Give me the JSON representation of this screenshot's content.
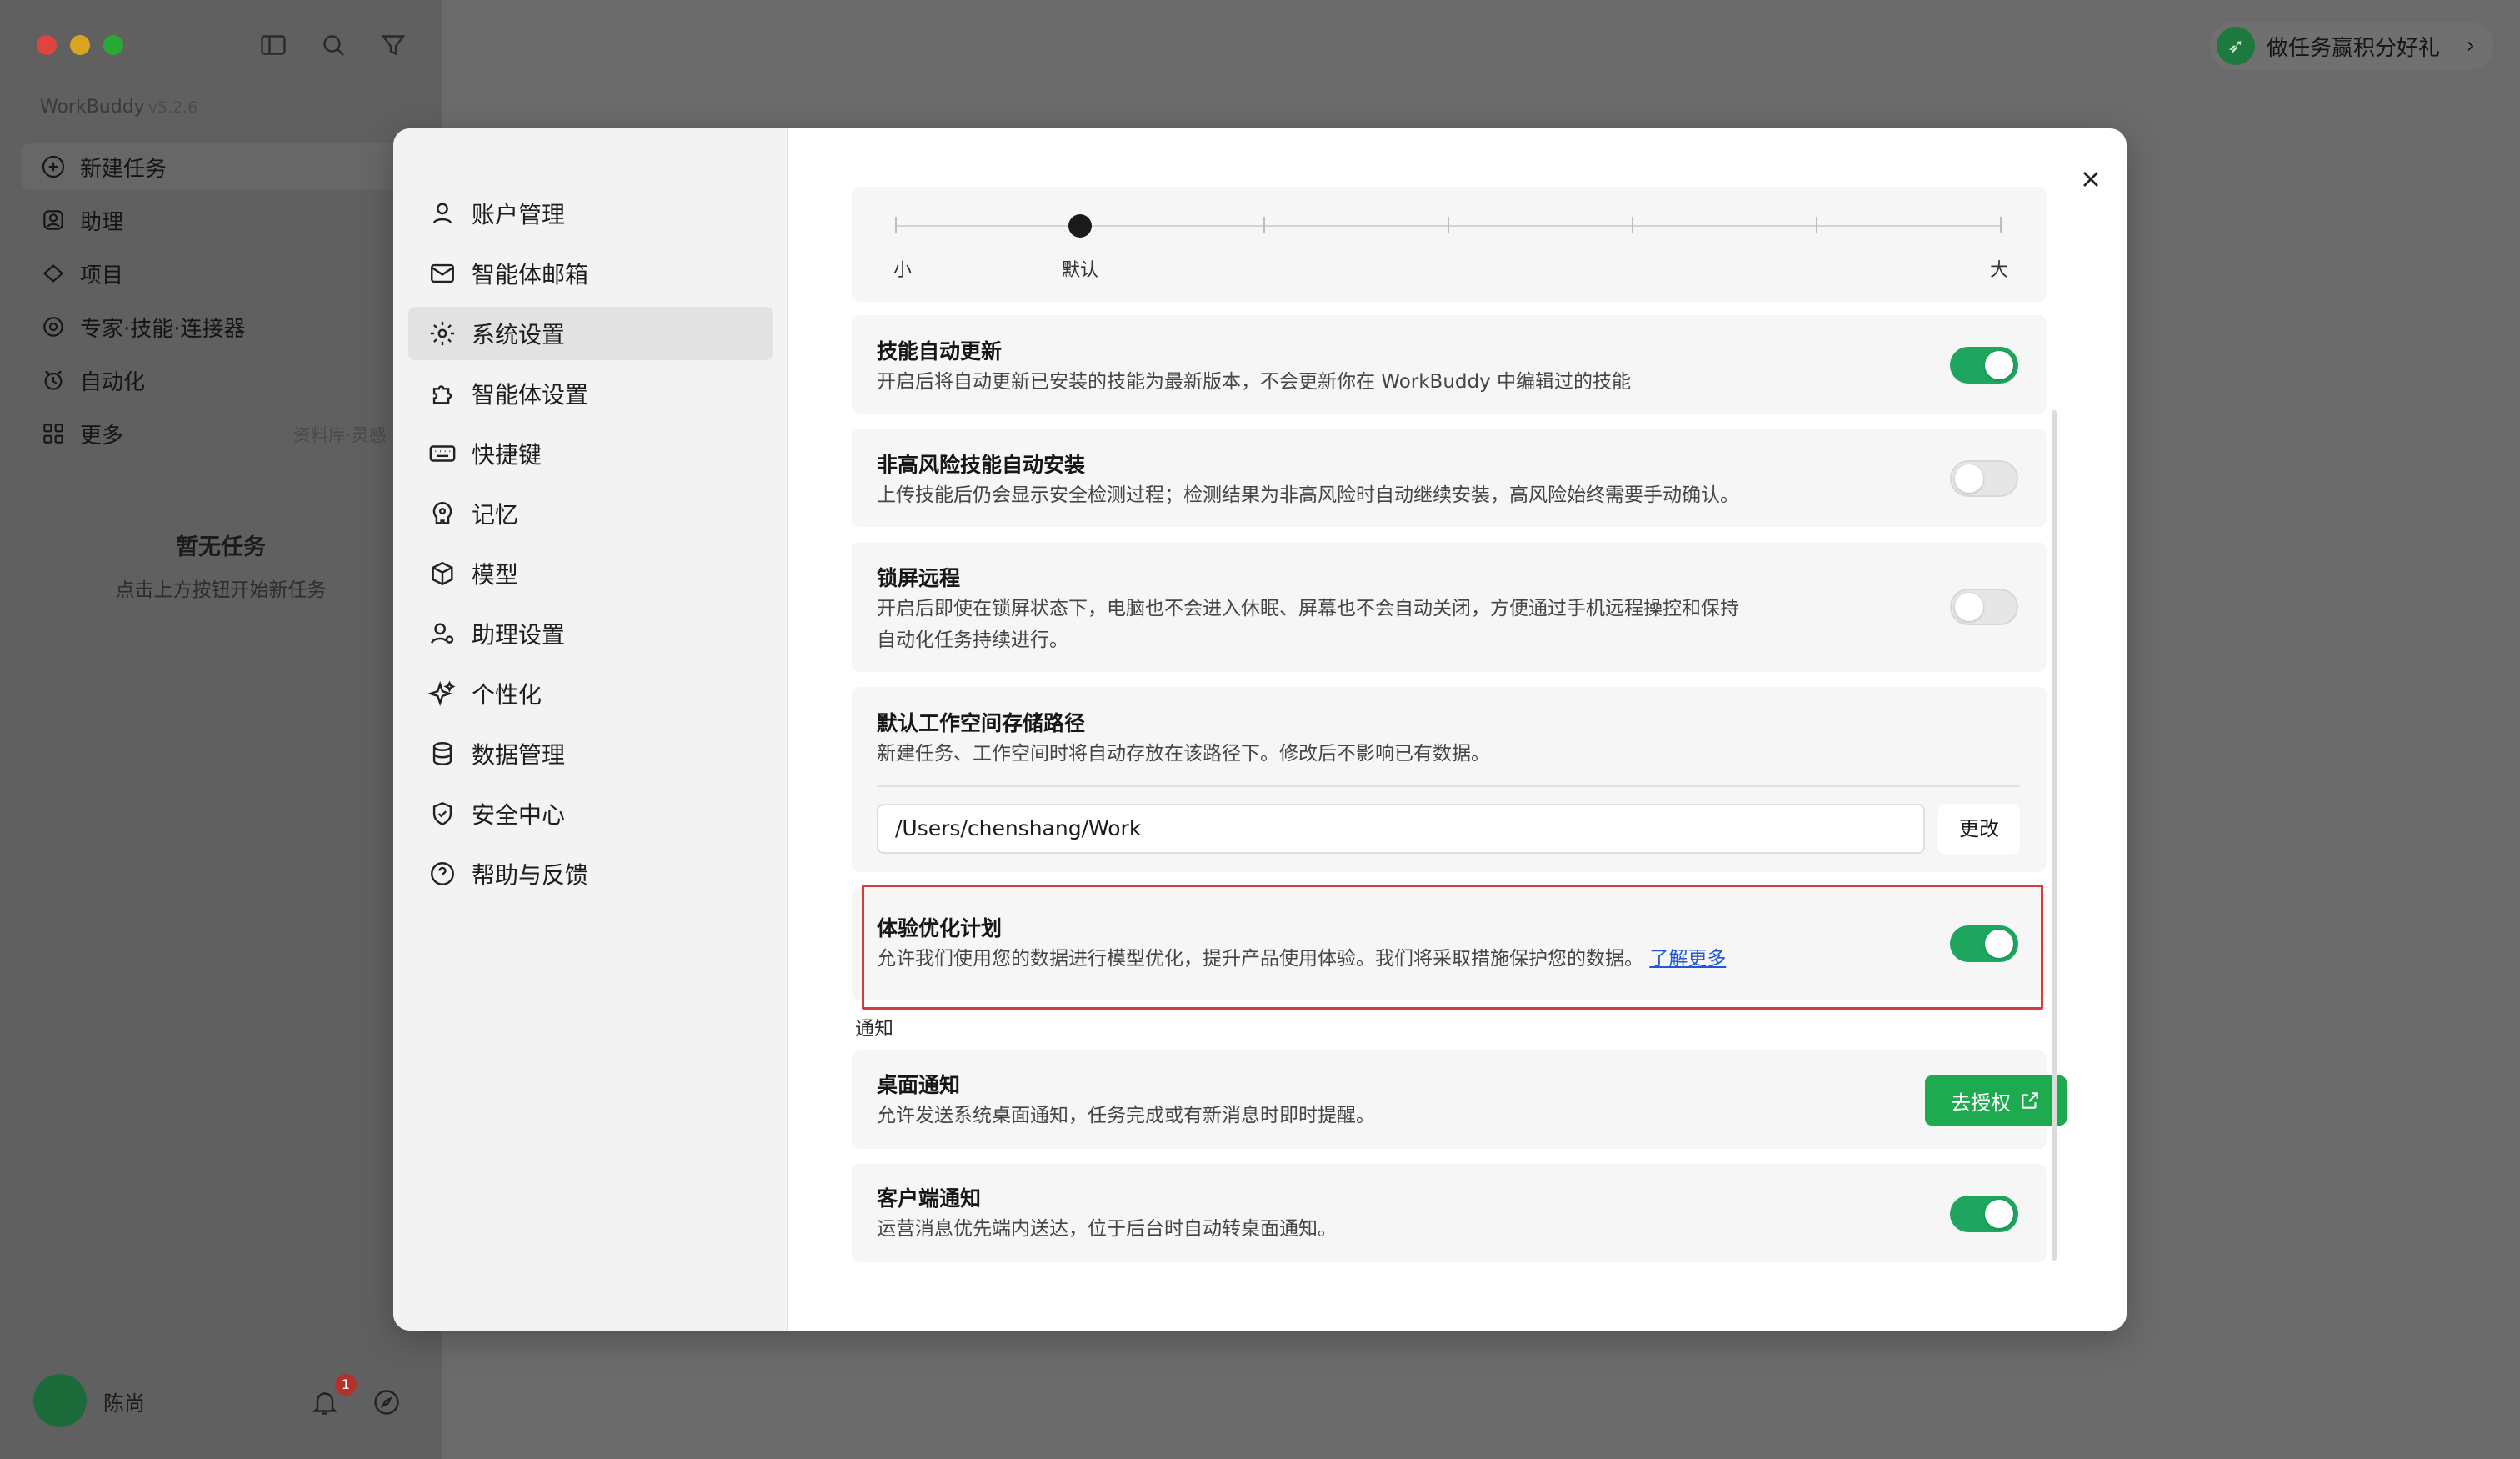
{
  "app": {
    "brand": "WorkBuddy",
    "version": "v5.2.6",
    "nav": [
      {
        "label": "新建任务",
        "icon": "plus-circle-icon"
      },
      {
        "label": "助理",
        "icon": "assistant-icon"
      },
      {
        "label": "项目",
        "icon": "project-icon"
      },
      {
        "label": "专家·技能·连接器",
        "icon": "expert-icon"
      },
      {
        "label": "自动化",
        "icon": "automation-icon"
      },
      {
        "label": "更多",
        "icon": "more-icon"
      }
    ],
    "nav_hint": "资料库·灵感",
    "empty_title": "暂无任务",
    "empty_sub": "点击上方按钮开始新任务",
    "user_name": "陈尚",
    "notification_count": "1",
    "promo": "做任务赢积分好礼"
  },
  "settings_nav": [
    {
      "label": "账户管理",
      "icon": "user-icon"
    },
    {
      "label": "智能体邮箱",
      "icon": "mail-icon"
    },
    {
      "label": "系统设置",
      "icon": "gear-icon",
      "active": true
    },
    {
      "label": "智能体设置",
      "icon": "puzzle-icon"
    },
    {
      "label": "快捷键",
      "icon": "keyboard-icon"
    },
    {
      "label": "记忆",
      "icon": "memory-icon"
    },
    {
      "label": "模型",
      "icon": "cube-icon"
    },
    {
      "label": "助理设置",
      "icon": "user-gear-icon"
    },
    {
      "label": "个性化",
      "icon": "sparkle-icon"
    },
    {
      "label": "数据管理",
      "icon": "database-icon"
    },
    {
      "label": "安全中心",
      "icon": "shield-icon"
    },
    {
      "label": "帮助与反馈",
      "icon": "help-icon"
    }
  ],
  "font_slider": {
    "label_small": "小",
    "label_default": "默认",
    "label_large": "大",
    "value_step": 1,
    "steps": 7
  },
  "settings": {
    "skill_update": {
      "title": "技能自动更新",
      "desc": "开启后将自动更新已安装的技能为最新版本，不会更新你在 WorkBuddy 中编辑过的技能",
      "enabled": true
    },
    "auto_install": {
      "title": "非高风险技能自动安装",
      "desc": "上传技能后仍会显示安全检测过程；检测结果为非高风险时自动继续安装，高风险始终需要手动确认。",
      "enabled": false
    },
    "lock_remote": {
      "title": "锁屏远程",
      "desc_line1": "开启后即使在锁屏状态下，电脑也不会进入休眠、屏幕也不会自动关闭，方便通过手机远程操控和保持",
      "desc_line2": "自动化任务持续进行。",
      "enabled": false
    },
    "workspace_path": {
      "title": "默认工作空间存储路径",
      "desc": "新建任务、工作空间时将自动存放在该路径下。修改后不影响已有数据。",
      "value": "/Users/chenshang/Work",
      "button": "更改"
    },
    "experience": {
      "title": "体验优化计划",
      "desc": "允许我们使用您的数据进行模型优化，提升产品使用体验。我们将采取措施保护您的数据。",
      "link": "了解更多",
      "enabled": true
    }
  },
  "notifications": {
    "section_label": "通知",
    "desktop": {
      "title": "桌面通知",
      "desc": "允许发送系统桌面通知，任务完成或有新消息时即时提醒。",
      "button": "去授权"
    },
    "client": {
      "title": "客户端通知",
      "desc": "运营消息优先端内送达，位于后台时自动转桌面通知。",
      "enabled": true
    }
  },
  "colors": {
    "accent": "#1ea55e",
    "highlight": "#d63b3f",
    "link": "#2258d6"
  }
}
